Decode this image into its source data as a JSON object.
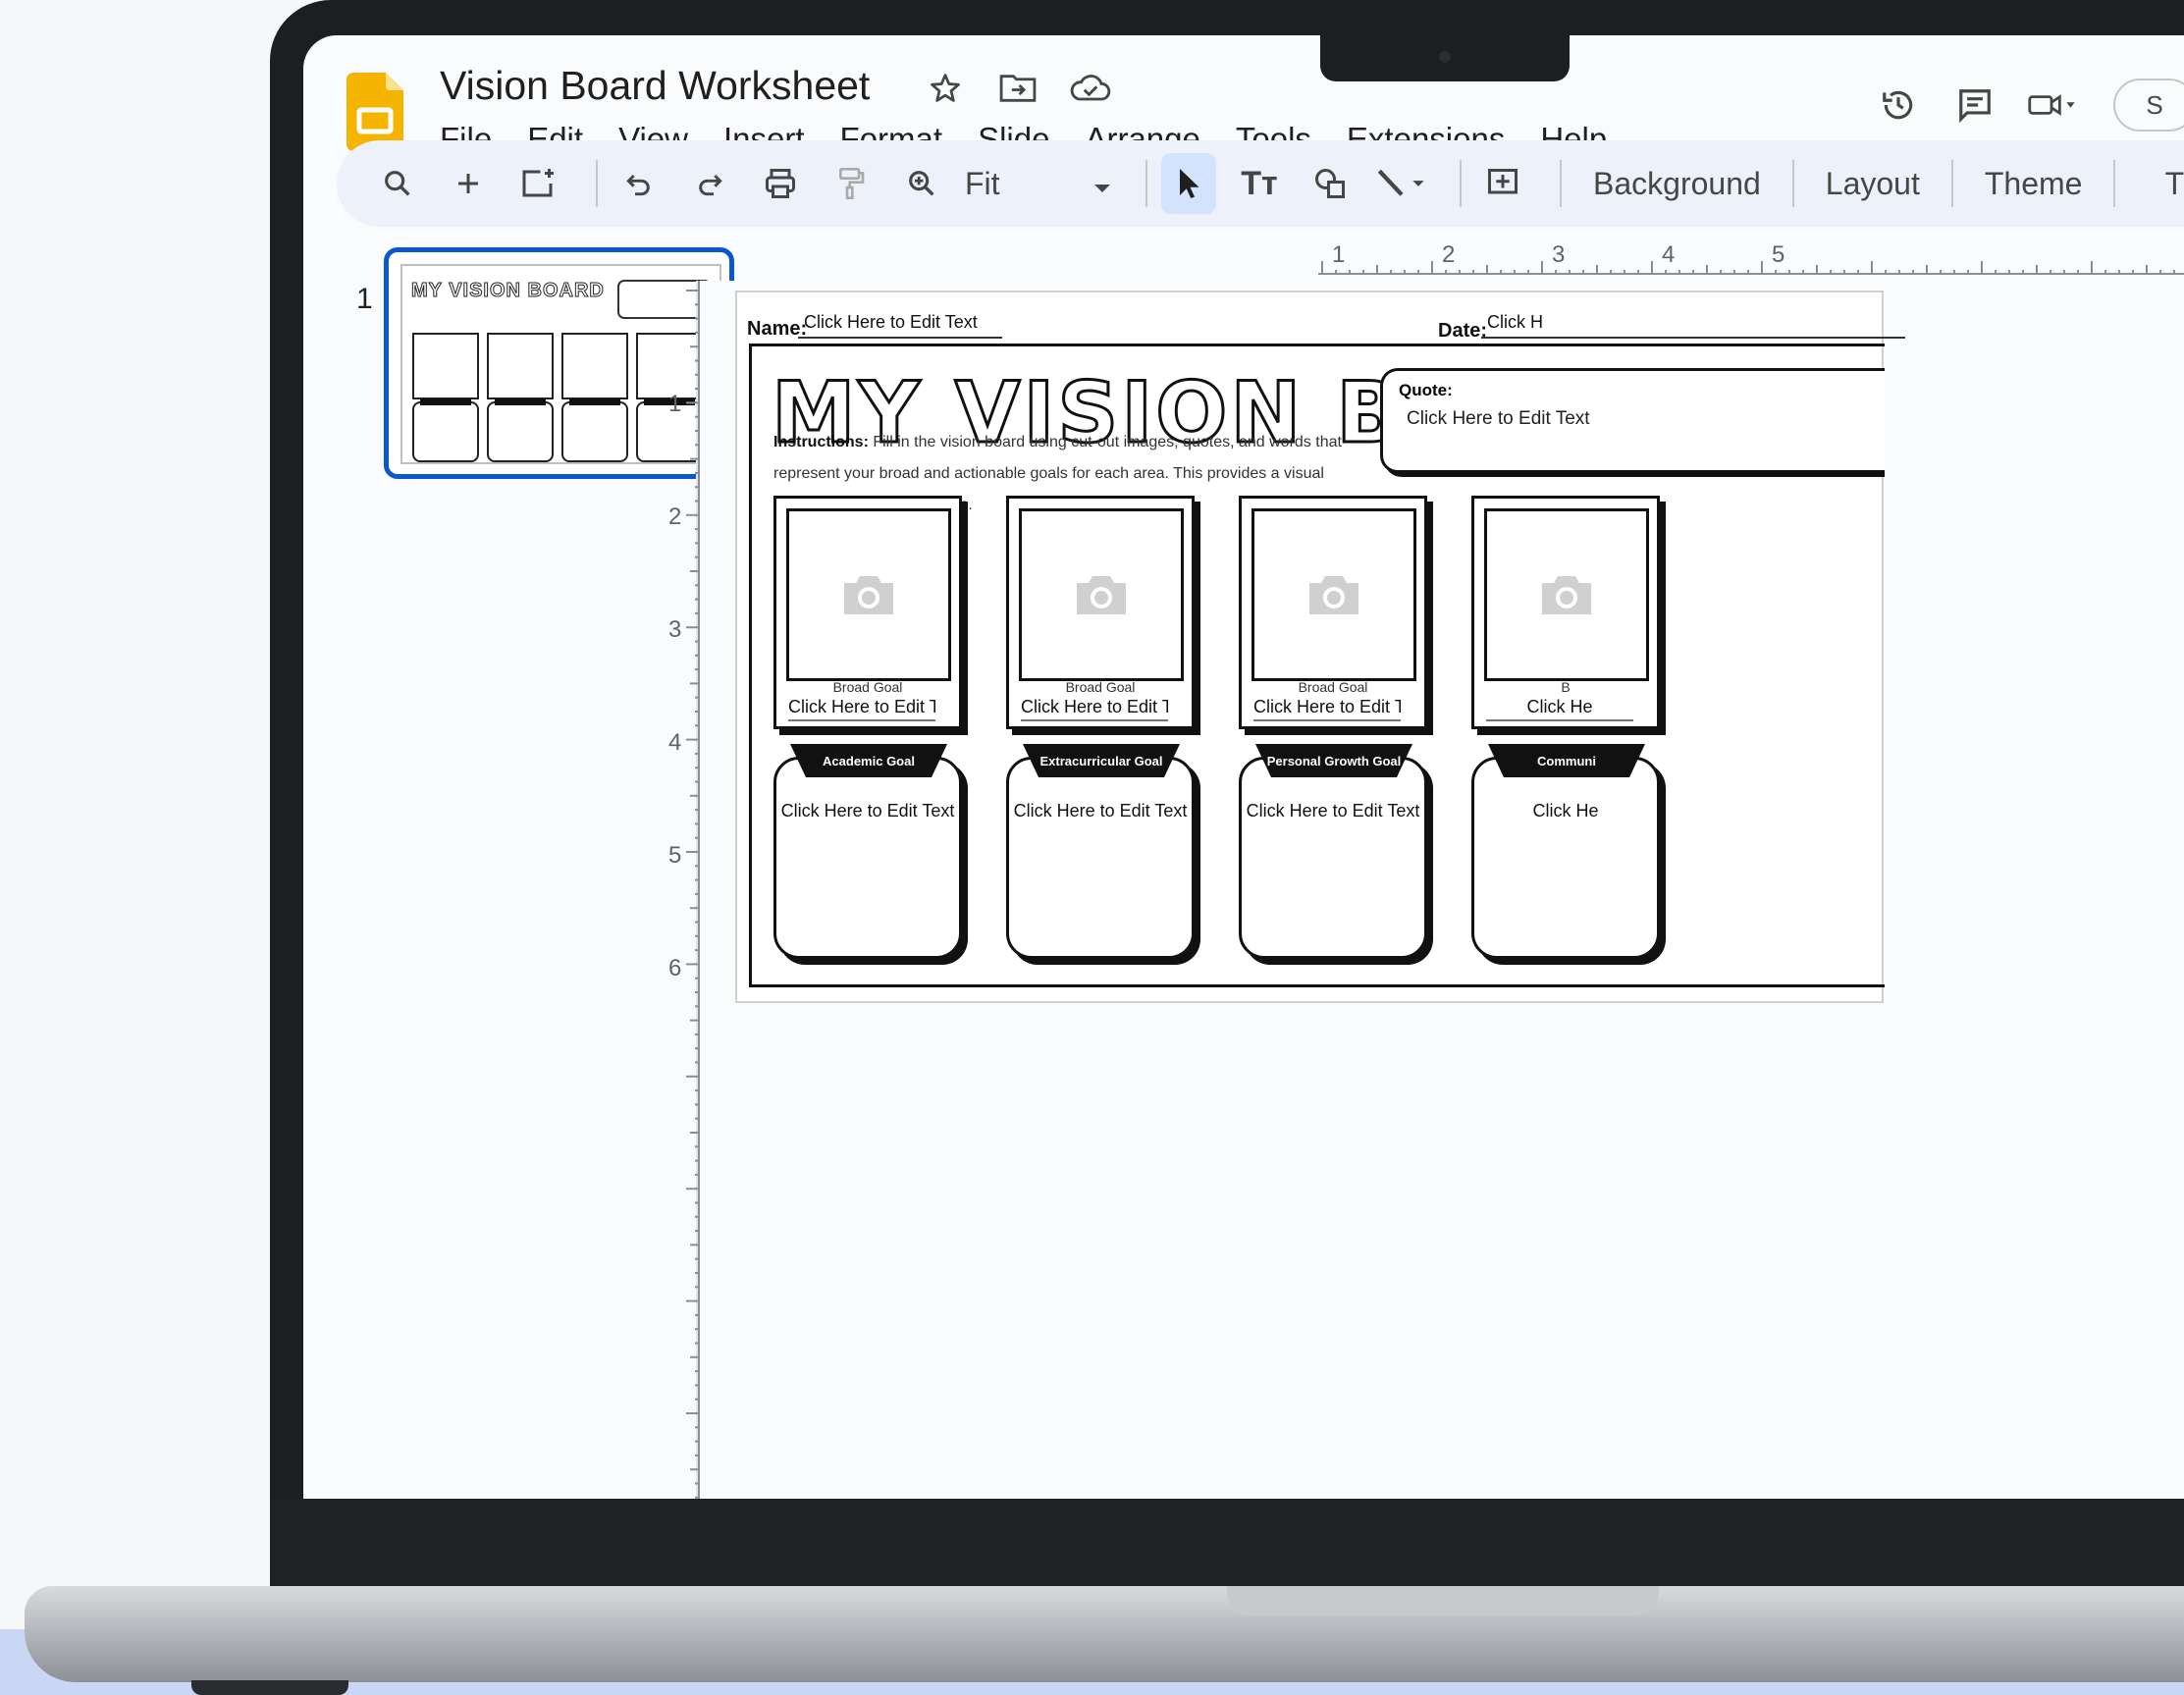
{
  "app": {
    "doc_title": "Vision Board Worksheet",
    "menu": [
      "File",
      "Edit",
      "View",
      "Insert",
      "Format",
      "Slide",
      "Arrange",
      "Tools",
      "Extensions",
      "Help"
    ],
    "title_icons": [
      "star-icon",
      "move-to-folder-icon",
      "cloud-saved-icon"
    ],
    "header_icons": [
      "version-history-icon",
      "comments-icon",
      "meet-camera-icon"
    ],
    "share_initial": "S",
    "brand_color": "#f4b400"
  },
  "toolbar": {
    "zoom": "Fit",
    "background": "Background",
    "layout": "Layout",
    "theme": "Theme",
    "transition_partial": "T",
    "text_format_glyph": "Tт"
  },
  "filmstrip": {
    "slide_number": "1",
    "thumb_title": "MY VISION BOARD"
  },
  "rulers": {
    "top": [
      "1",
      "2",
      "3",
      "4",
      "5"
    ],
    "left": [
      "1",
      "2",
      "3",
      "4",
      "5",
      "6"
    ]
  },
  "worksheet": {
    "name_label": "Name:",
    "name_value": "Click Here to Edit Text",
    "date_label": "Date:",
    "date_value": "Click H",
    "title": "MY VISION BOARD",
    "instructions_label": "Instructions:",
    "instructions_text": "Fill in the vision board using cut-out images, quotes, and words that represent your broad and actionable goals for each area. This provides a visual reminder of your aspirations.",
    "quote_label": "Quote:",
    "quote_value": "Click Here to Edit Text",
    "photo_cards": [
      {
        "sub": "Broad Goal",
        "edit": "Click Here to Edit Text"
      },
      {
        "sub": "Broad Goal",
        "edit": "Click Here to Edit Text"
      },
      {
        "sub": "Broad Goal",
        "edit": "Click Here to Edit Text"
      },
      {
        "sub": "B",
        "edit": "Click He"
      }
    ],
    "goal_boxes": [
      {
        "tab": "Academic Goal",
        "value": "Click Here to Edit Text"
      },
      {
        "tab": "Extracurricular Goal",
        "value": "Click Here to Edit Text"
      },
      {
        "tab": "Personal Growth Goal",
        "value": "Click Here to Edit Text"
      },
      {
        "tab": "Communi",
        "value": "Click He"
      }
    ]
  }
}
